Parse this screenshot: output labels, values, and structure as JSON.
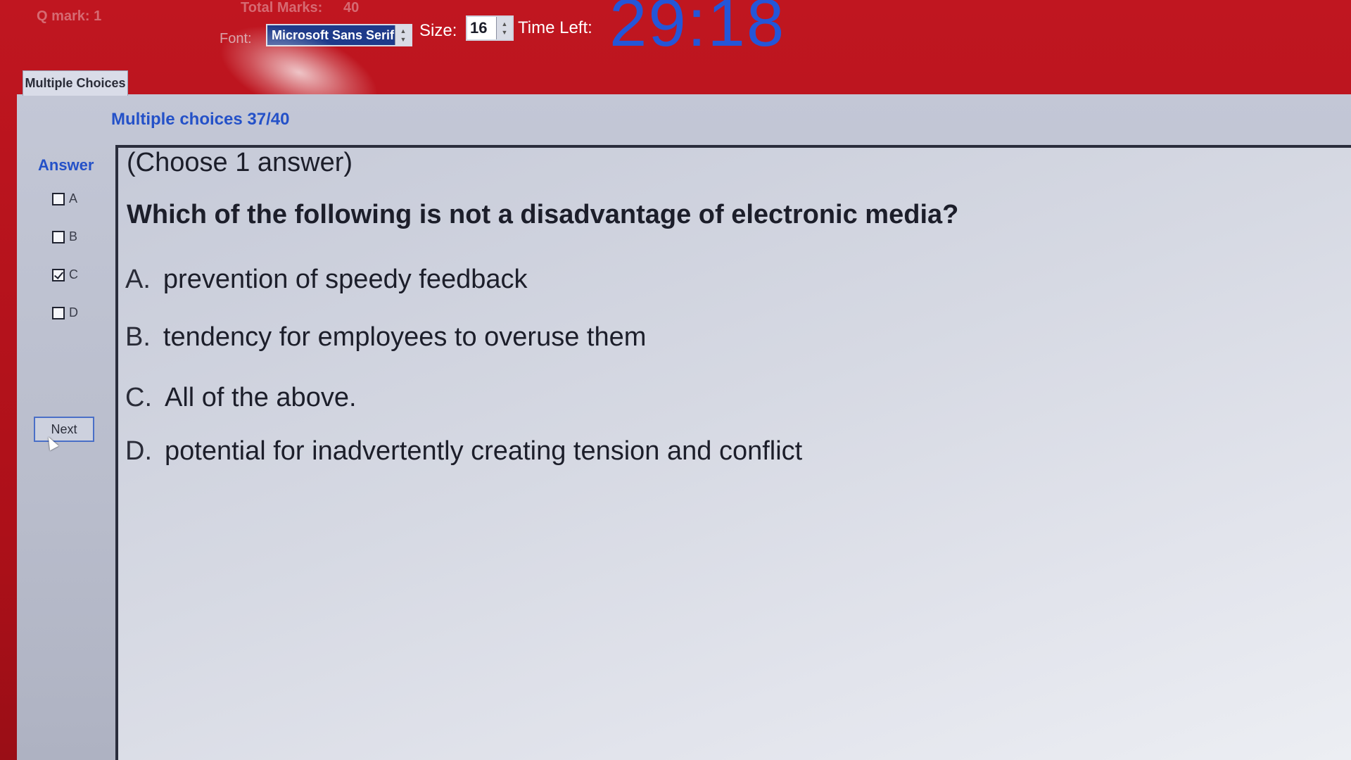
{
  "header": {
    "question_mark_label": "Q mark: 1",
    "total_marks_label": "Total Marks:",
    "total_marks_value": "40",
    "font_label": "Font:",
    "font_value": "Microsoft Sans Serif",
    "size_label": "Size:",
    "size_value": "16",
    "time_left_label": "Time Left:",
    "timer": "29:18"
  },
  "tab": {
    "label": "Multiple Choices"
  },
  "subtitle": "Multiple choices 37/40",
  "sidebar": {
    "answer_title": "Answer",
    "options": [
      {
        "label": "A",
        "checked": false
      },
      {
        "label": "B",
        "checked": false
      },
      {
        "label": "C",
        "checked": true
      },
      {
        "label": "D",
        "checked": false
      }
    ],
    "next_label": "Next"
  },
  "question": {
    "instruction": "(Choose 1 answer)",
    "text": "Which of the following is not a disadvantage of electronic media?",
    "options": [
      {
        "letter": "A.",
        "text": "prevention of speedy feedback"
      },
      {
        "letter": "B.",
        "text": "tendency for employees to overuse them"
      },
      {
        "letter": "C.",
        "text": "All of the above."
      },
      {
        "letter": "D.",
        "text": "potential for inadvertently creating tension and conflict"
      }
    ]
  },
  "colors": {
    "header_bg": "#c01620",
    "timer": "#2456d8",
    "accent_blue": "#2451c8",
    "panel_bg": "#c3c7d6"
  }
}
